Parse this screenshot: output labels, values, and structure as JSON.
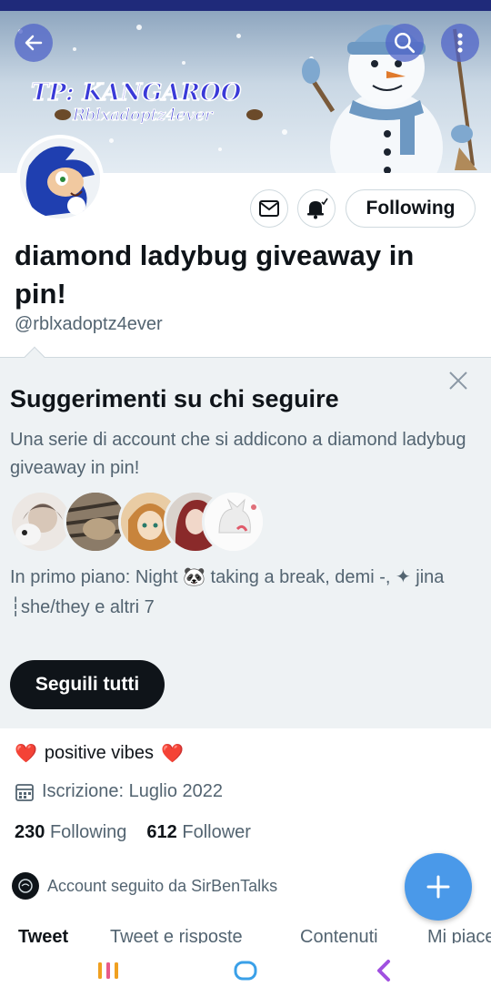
{
  "profile": {
    "display_name": "diamond ladybug giveaway in pin!",
    "handle": "@rblxadoptz4ever",
    "banner_text_main": "TP: KANGAROO",
    "banner_text_sub": "Rblxadoptz4ever",
    "follow_label": "Following"
  },
  "suggestions": {
    "title": "Suggerimenti su chi seguire",
    "description": "Una serie di account che si addicono a diamond ladybug giveaway in pin!",
    "featured": "In primo piano: Night 🐼 taking a break, demi -, ✦ jina ┆she/they e altri 7",
    "follow_all_label": "Seguili tutti"
  },
  "bio": {
    "heart_left": "❤️",
    "text": "positive vibes",
    "heart_right": "❤️"
  },
  "joined": "Iscrizione: Luglio 2022",
  "stats": {
    "following_count": "230",
    "following_label": "Following",
    "follower_count": "612",
    "follower_label": "Follower"
  },
  "followed_by": "Account seguito da SirBenTalks",
  "tabs": [
    "Tweet",
    "Tweet e risposte",
    "Contenuti",
    "Mi piace"
  ],
  "colors": {
    "accent": "#4a99e9",
    "dark": "#0f1419",
    "muted": "#536471",
    "panel": "#eef2f4"
  },
  "icons": [
    "back-arrow-icon",
    "search-icon",
    "more-icon",
    "mail-icon",
    "bell-icon",
    "close-icon",
    "calendar-icon",
    "plus-icon",
    "recent-apps-icon",
    "home-icon",
    "back-icon"
  ]
}
